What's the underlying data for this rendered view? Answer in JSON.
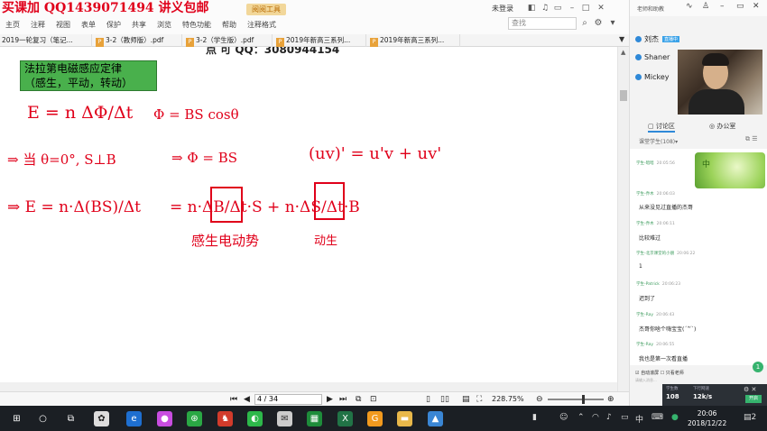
{
  "app": {
    "banner": "买课加 QQ1439071494 讲义包邮",
    "reader_badge": "阅阅工具",
    "not_logged_in": "未登录",
    "search_placeholder": "查找",
    "menu": [
      "主页",
      "注释",
      "视图",
      "表单",
      "保护",
      "共享",
      "浏览",
      "特色功能",
      "帮助",
      "注释格式"
    ]
  },
  "tabs": [
    {
      "label": "2019一轮复习（笔记..."
    },
    {
      "label": "3-2（教师版）.pdf"
    },
    {
      "label": "3-2（学生版）.pdf"
    },
    {
      "label": "2019年新高三系列..."
    },
    {
      "label": "2019年新高三系列..."
    }
  ],
  "document": {
    "qq_line": "点 可 QQ：3080944154",
    "title_line1": "法拉第电磁感应定律",
    "title_line2": "（感生，平动，转动）",
    "handwriting": {
      "l1a": "E = n ΔΦ/Δt",
      "l1b": "Φ = BS cosθ",
      "l2a": "⇒ 当 θ=0°, S⊥B",
      "l2b": "⇒ Φ = BS",
      "l2c": "(uv)' = u'v + uv'",
      "l3a": "⇒ E = n·Δ(BS)/Δt",
      "l3b": "= n·ΔB/Δt·S + n·ΔS/Δt·B",
      "l4a": "感生电动势",
      "l4b": "动生"
    }
  },
  "status": {
    "page": "4 / 34",
    "zoom": "228.75%"
  },
  "panel": {
    "title": "老师和助教",
    "users": [
      {
        "name": "刘杰",
        "badge": "直播中"
      },
      {
        "name": "Shaner",
        "badge": ""
      },
      {
        "name": "Mickey",
        "badge": ""
      }
    ],
    "tab_discussion": "讨论区",
    "tab_office": "办公室",
    "filter_label": "课堂学生(108)",
    "sticker_text": "中",
    "messages": [
      {
        "user": "学生-暗暗",
        "time": "20:05:56",
        "text": ""
      },
      {
        "user": "学生-乔木",
        "time": "20:06:03",
        "text": "从来没见过直播的杰哥"
      },
      {
        "user": "学生-乔木",
        "time": "20:06:11",
        "text": "比较难过"
      },
      {
        "user": "学生-北京课堂的小朋",
        "time": "20:06:22",
        "text": "1"
      },
      {
        "user": "学生-Patrick",
        "time": "20:06:23",
        "text": "迟到了"
      },
      {
        "user": "学生-Ray",
        "time": "20:06:43",
        "text": "杰哥你啥个嗨宝宝(ˊ꒳ˋ)"
      },
      {
        "user": "学生-Ray",
        "time": "20:06:55",
        "text": "我也是第一次看直播"
      }
    ],
    "new_count": "1",
    "opt_auto_scroll": "自动滚屏",
    "opt_teacher_only": "只看老师",
    "input_placeholder": "请输入消息...",
    "stat_students_label": "学生数",
    "stat_students": "108",
    "stat_speed_label": "下行网速",
    "stat_speed": "12k/s",
    "live_label": "开启"
  },
  "taskbar": {
    "time": "20:06",
    "date": "2018/12/22",
    "ime": "中",
    "notif": "2"
  },
  "colors": {
    "banner": "#e0001a",
    "ink": "#e0001a",
    "title_box": "#49b04c",
    "taskbar": "#1b1f24"
  }
}
